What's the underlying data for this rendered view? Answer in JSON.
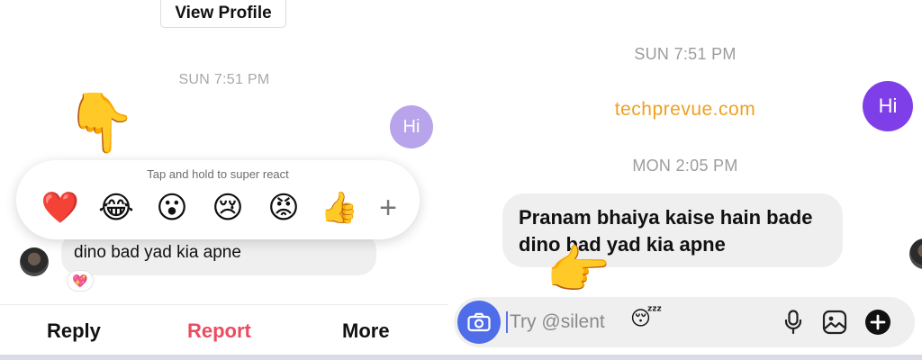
{
  "left": {
    "view_profile_label": "View Profile",
    "timestamp": "SUN 7:51 PM",
    "sent_message": "Hi",
    "reaction_picker": {
      "hint": "Tap and hold to super react",
      "emojis": [
        "❤️",
        "😂",
        "😮",
        "😢",
        "😡",
        "👍"
      ],
      "more_symbol": "+"
    },
    "pointer_emoji": "👇",
    "received_message_visible": "dino bad yad kia apne",
    "reaction_badge": "💖",
    "actions": {
      "reply": "Reply",
      "report": "Report",
      "more": "More"
    },
    "report_color": "#ec4b60"
  },
  "right": {
    "timestamp_1": "SUN 7:51 PM",
    "sent_message": "Hi",
    "watermark": "techprevue.com",
    "timestamp_2": "MON 2:05 PM",
    "received_message": {
      "line1": "Pranam bhaiya kaise hain bade",
      "line2": "dino bad yad kia apne"
    },
    "reaction_badge": "😂",
    "pointer_emoji": "👉",
    "composer": {
      "placeholder": "Try @silent",
      "placeholder_emoji": "😴"
    },
    "accent_color": "#7e3fe8",
    "camera_button_color": "#4f6de8"
  }
}
